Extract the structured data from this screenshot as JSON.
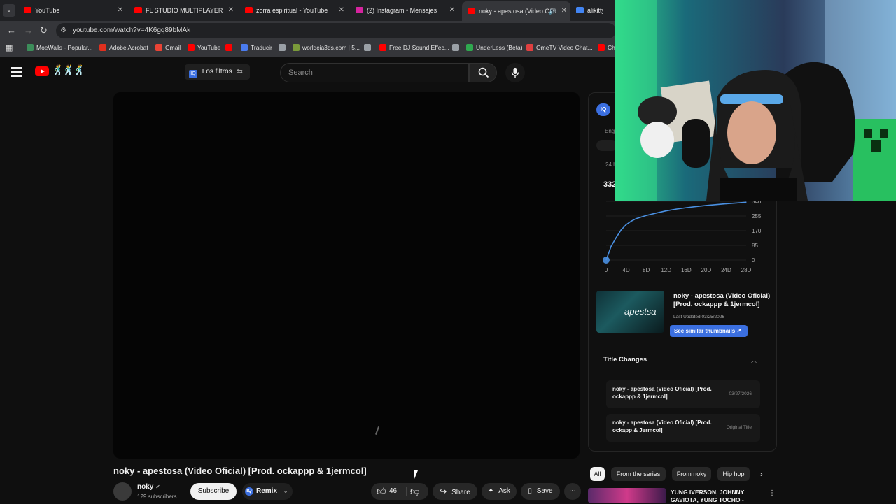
{
  "browser": {
    "tabs": [
      {
        "title": "YouTube",
        "active": false,
        "color": "#ff0000"
      },
      {
        "title": "FL STUDIO MULTIPLAYER ES UN",
        "active": false,
        "color": "#ff0000"
      },
      {
        "title": "zorra espiritual - YouTube",
        "active": false,
        "color": "#ff0000"
      },
      {
        "title": "(2) Instagram • Mensajes",
        "active": false,
        "color": "#d6249f"
      },
      {
        "title": "noky - apestosa (Video Ofic",
        "active": true,
        "color": "#ff0000"
      },
      {
        "title": "alikitty.wav",
        "active": false,
        "color": "#4285f4"
      }
    ],
    "close_glyph": "✕",
    "speaker_glyph": "🔊",
    "url": "youtube.com/watch?v=4K6gq89bMAk",
    "bookmarks": [
      {
        "label": "MoeWalls - Popular...",
        "color": "#3c8d5a"
      },
      {
        "label": "Adobe Acrobat",
        "color": "#e0301e"
      },
      {
        "label": "Gmail",
        "color": "#ea4335"
      },
      {
        "label": "YouTube",
        "color": "#ff0000"
      },
      {
        "label": "",
        "color": "#ff0000"
      },
      {
        "label": "Traducir",
        "color": "#4a7cf0"
      },
      {
        "label": "",
        "color": "#9aa0a6"
      },
      {
        "label": "worldcia3ds.com | 5...",
        "color": "#7a9a3a"
      },
      {
        "label": "",
        "color": "#9aa0a6"
      },
      {
        "label": "Free DJ Sound Effec...",
        "color": "#ff0000"
      },
      {
        "label": "",
        "color": "#9aa0a6"
      },
      {
        "label": "UnderLess (Beta)",
        "color": "#2fa84f"
      },
      {
        "label": "OmeTV Video Chat...",
        "color": "#e04040"
      },
      {
        "label": "Ch",
        "color": "#ff0000"
      }
    ]
  },
  "youtube": {
    "filters_label": "Los filtros",
    "iq_label": "IQ",
    "search_placeholder": "Search",
    "video_title": "noky - apestosa (Video Oficial) [Prod. ockappp & 1jermcol]",
    "channel_name": "noky",
    "subscribers": "129 subscribers",
    "subscribe_label": "Subscribe",
    "remix_label": "Remix",
    "like_count": "46",
    "share_label": "Share",
    "ask_label": "Ask",
    "save_label": "Save"
  },
  "side_panel": {
    "partial_labels": {
      "eng": "Eng",
      "hours": "24 h",
      "views": "332"
    },
    "chart_data": {
      "type": "line",
      "title": "",
      "xlabel": "",
      "ylabel": "",
      "x_ticks": [
        "0",
        "4D",
        "8D",
        "12D",
        "16D",
        "20D",
        "24D",
        "28D"
      ],
      "y_ticks": [
        "0",
        "85",
        "170",
        "255",
        "340"
      ],
      "x": [
        0,
        0.5,
        1,
        2,
        3,
        4,
        5,
        6,
        8,
        10,
        12,
        14,
        16,
        18,
        20,
        22,
        24,
        26,
        28
      ],
      "values": [
        0,
        40,
        80,
        130,
        175,
        205,
        225,
        240,
        258,
        272,
        285,
        295,
        303,
        310,
        316,
        321,
        326,
        330,
        335
      ],
      "xlim": [
        0,
        28
      ],
      "ylim": [
        0,
        340
      ],
      "line_color": "#4a90e2",
      "grid": true
    },
    "suggestion": {
      "title": "noky - apestosa (Video Oficial) [Prod. ockappp & 1jermcol]",
      "thumb_text": "apestsa",
      "last_updated": "Last Updated 03/25/2026",
      "similar_label": "See similar thumbnails ↗"
    },
    "title_changes": {
      "heading": "Title Changes",
      "items": [
        {
          "title": "noky - apestosa (Video Oficial) [Prod. ockappp & 1jermcol]",
          "date": "03/27/2026"
        },
        {
          "title": "noky - apestosa (Video Oficial) [Prod. ockapp & Jermcol]",
          "date": "Original Title"
        }
      ]
    }
  },
  "chips": [
    "All",
    "From the series",
    "From noky",
    "Hip hop"
  ],
  "related": {
    "title": "YUNG IVERSON, JOHNNY GAVIOTA, YUNG TOCHO -"
  }
}
